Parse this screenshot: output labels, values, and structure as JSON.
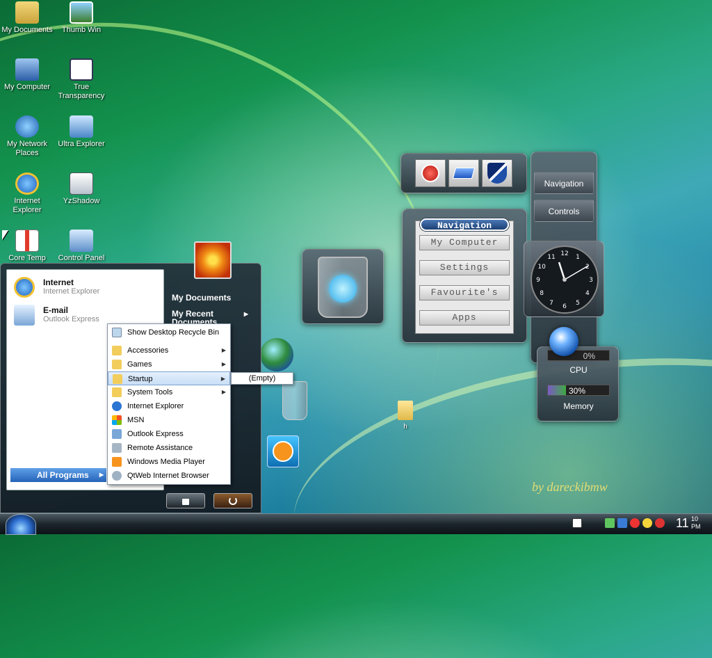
{
  "desktop": {
    "icons": [
      {
        "label": "My Documents"
      },
      {
        "label": "Thumb Win"
      },
      {
        "label": "My Computer"
      },
      {
        "label": "True Transparency"
      },
      {
        "label": "My Network Places"
      },
      {
        "label": "Ultra Explorer"
      },
      {
        "label": "Internet Explorer"
      },
      {
        "label": "YzShadow"
      },
      {
        "label": "Core Temp"
      },
      {
        "label": "Control Panel"
      }
    ],
    "folder_label": "h",
    "watermark": "by dareckibmw"
  },
  "nav_widget": {
    "title": "Navigation",
    "buttons": [
      "My Computer",
      "Settings",
      "Favourite's",
      "Apps"
    ]
  },
  "side_widget": {
    "buttons": [
      "Navigation",
      "Controls"
    ]
  },
  "clock": {
    "numbers": [
      "12",
      "1",
      "2",
      "3",
      "4",
      "5",
      "6",
      "7",
      "8",
      "9",
      "10",
      "11"
    ]
  },
  "meters": {
    "cpu": {
      "label": "CPU",
      "value": "0%",
      "fraction": 0.0
    },
    "memory": {
      "label": "Memory",
      "value": "30%",
      "fraction": 0.3
    }
  },
  "start_menu": {
    "pinned": [
      {
        "title": "Internet",
        "subtitle": "Internet Explorer"
      },
      {
        "title": "E-mail",
        "subtitle": "Outlook Express"
      }
    ],
    "right": [
      "My Documents",
      "My Recent Documents"
    ],
    "all_programs": "All Programs"
  },
  "submenu": {
    "items": [
      {
        "label": "Show Desktop Recycle Bin",
        "arrow": false
      },
      {
        "label": "Accessories",
        "arrow": true
      },
      {
        "label": "Games",
        "arrow": true
      },
      {
        "label": "Startup",
        "arrow": true
      },
      {
        "label": "System Tools",
        "arrow": true
      },
      {
        "label": "Internet Explorer",
        "arrow": false
      },
      {
        "label": "MSN",
        "arrow": false
      },
      {
        "label": "Outlook Express",
        "arrow": false
      },
      {
        "label": "Remote Assistance",
        "arrow": false
      },
      {
        "label": "Windows Media Player",
        "arrow": false
      },
      {
        "label": "QtWeb Internet Browser",
        "arrow": false
      }
    ],
    "startup_empty": "(Empty)"
  },
  "taskbar": {
    "clock_hour": "11",
    "clock_minutes": "10",
    "clock_ampm": "PM"
  },
  "colors": {
    "accent_blue": "#2f6fd1",
    "power_red": "#d0281e",
    "meter_purple": "#7b5bc4",
    "meter_green": "#3ea843"
  }
}
